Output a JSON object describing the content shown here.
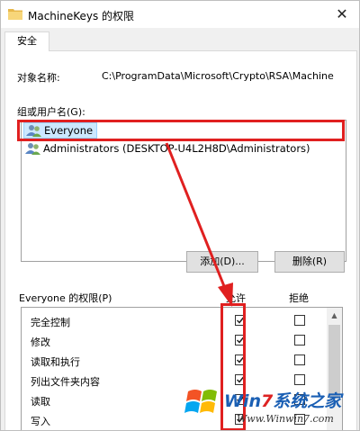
{
  "window": {
    "title": "MachineKeys 的权限",
    "close_glyph": "✕"
  },
  "tabs": [
    {
      "label": "安全"
    }
  ],
  "object": {
    "label": "对象名称:",
    "value": "C:\\ProgramData\\Microsoft\\Crypto\\RSA\\Machine"
  },
  "groups": {
    "label": "组或用户名(G):",
    "items": [
      {
        "name": "Everyone",
        "icon": "users-icon",
        "selected": true
      },
      {
        "name": "Administrators (DESKTOP-U4L2H8D\\Administrators)",
        "icon": "users-icon",
        "selected": false
      }
    ]
  },
  "buttons": {
    "add": "添加(D)...",
    "remove": "删除(R)"
  },
  "permissions": {
    "label": "Everyone 的权限(P)",
    "allow_header": "允许",
    "deny_header": "拒绝",
    "rows": [
      {
        "name": "完全控制",
        "allow": true,
        "deny": false
      },
      {
        "name": "修改",
        "allow": true,
        "deny": false
      },
      {
        "name": "读取和执行",
        "allow": true,
        "deny": false
      },
      {
        "name": "列出文件夹内容",
        "allow": true,
        "deny": false
      },
      {
        "name": "读取",
        "allow": true,
        "deny": false
      },
      {
        "name": "写入",
        "allow": true,
        "deny": false
      }
    ]
  },
  "watermark": {
    "brand_a": "Win",
    "brand_num": "7",
    "brand_b": "系统之家",
    "site": "Www.Winwin7.com"
  },
  "colors": {
    "annotation": "#e02020",
    "selection": "#cce8ff",
    "brand_blue": "#1a5fb4"
  }
}
